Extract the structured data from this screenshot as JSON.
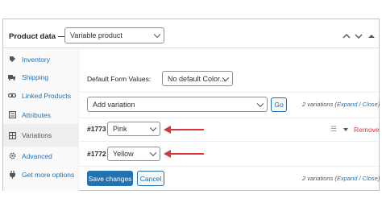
{
  "header": {
    "title": "Product data —",
    "product_type": "Variable product",
    "icons": [
      "chevron-up-icon",
      "chevron-down-icon",
      "collapse-arrow-icon"
    ]
  },
  "sidebar": {
    "items": [
      {
        "label": "Inventory",
        "icon": "inventory-icon"
      },
      {
        "label": "Shipping",
        "icon": "truck-icon"
      },
      {
        "label": "Linked Products",
        "icon": "link-icon"
      },
      {
        "label": "Attributes",
        "icon": "tag-icon"
      },
      {
        "label": "Variations",
        "icon": "grid-icon",
        "active": true
      },
      {
        "label": "Advanced",
        "icon": "gear-icon"
      },
      {
        "label": "Get more options",
        "icon": "plug-icon"
      }
    ]
  },
  "variations": {
    "default_form_label": "Default Form Values:",
    "default_form_value": "No default Color...",
    "action_select": "Add variation",
    "go_label": "Go",
    "count_text": "2 variations (",
    "expand_label": "Expand",
    "separator": " / ",
    "close_label": "Close",
    "count_suffix": ")",
    "rows": [
      {
        "id": "#1773",
        "value": "Pink",
        "remove": "Remove"
      },
      {
        "id": "#1772",
        "value": "Yellow"
      }
    ],
    "save_label": "Save changes",
    "cancel_label": "Cancel",
    "meta_bottom_text": "2 variations (",
    "meta_bottom_expand": "Expand",
    "meta_bottom_close": "Close"
  },
  "colors": {
    "accent": "#2271b1",
    "danger": "#d63638",
    "annotation_arrow": "#d63638"
  }
}
